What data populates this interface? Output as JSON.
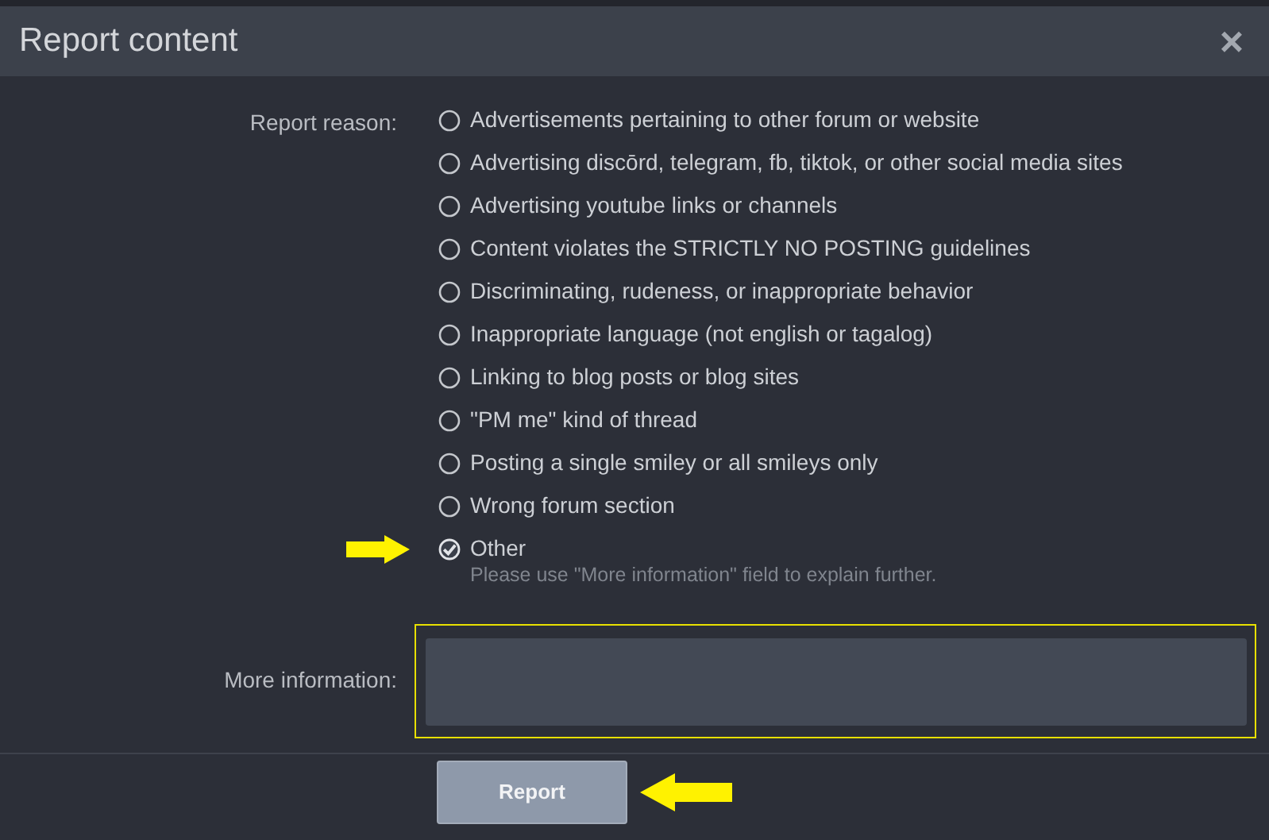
{
  "dialog": {
    "title": "Report content",
    "close": "×"
  },
  "reason_label": "Report reason:",
  "reasons": [
    {
      "label": "Advertisements pertaining to other forum or website",
      "selected": false
    },
    {
      "label": "Advertising discōrd, telegram, fb, tiktok, or other social media sites",
      "selected": false
    },
    {
      "label": "Advertising youtube links or channels",
      "selected": false
    },
    {
      "label": "Content violates the STRICTLY NO POSTING guidelines",
      "selected": false
    },
    {
      "label": "Discriminating, rudeness, or inappropriate behavior",
      "selected": false
    },
    {
      "label": "Inappropriate language (not english or tagalog)",
      "selected": false
    },
    {
      "label": "Linking to blog posts or blog sites",
      "selected": false
    },
    {
      "label": "\"PM me\" kind of thread",
      "selected": false
    },
    {
      "label": "Posting a single smiley or all smileys only",
      "selected": false
    },
    {
      "label": "Wrong forum section",
      "selected": false
    },
    {
      "label": "Other",
      "selected": true,
      "hint": "Please use \"More information\" field to explain further."
    }
  ],
  "more_info": {
    "label": "More information:"
  },
  "submit": "Report"
}
